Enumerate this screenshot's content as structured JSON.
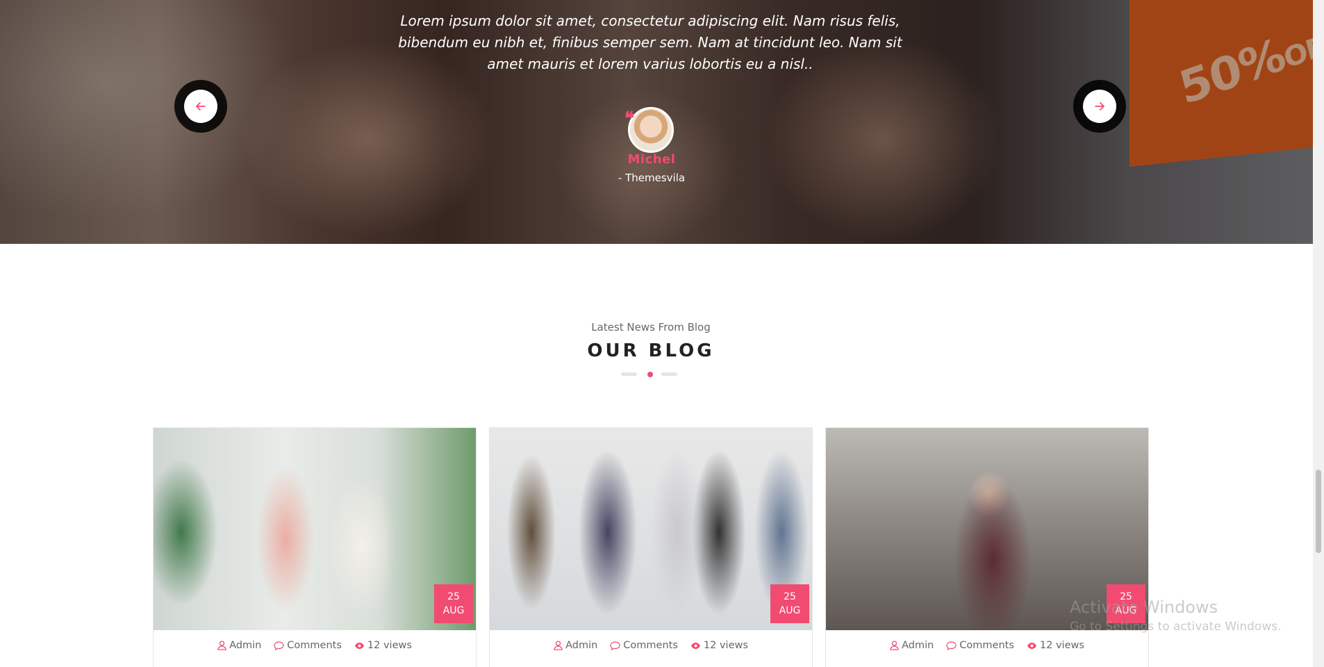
{
  "testimonial": {
    "quote": "Lorem ipsum dolor sit amet, consectetur adipiscing elit. Nam risus felis, bibendum eu nibh et, finibus semper sem. Nam at tincidunt leo. Nam sit amet mauris et lorem varius lobortis eu a nisl..",
    "author_name": "Michel",
    "author_company": "- Themesvila",
    "quote_mark": "❝",
    "prev_icon": "arrow-left-icon",
    "next_icon": "arrow-right-icon",
    "background_sign_text": "50%",
    "background_sign_small": "OFF"
  },
  "blog": {
    "subtitle": "Latest News From Blog",
    "title": "OUR BLOG",
    "accent_color": "#f14b71",
    "posts": [
      {
        "day": "25",
        "month": "AUG",
        "author": "Admin",
        "comments": "Comments",
        "views": "12 views"
      },
      {
        "day": "25",
        "month": "AUG",
        "author": "Admin",
        "comments": "Comments",
        "views": "12 views"
      },
      {
        "day": "25",
        "month": "AUG",
        "author": "Admin",
        "comments": "Comments",
        "views": "12 views"
      }
    ]
  },
  "watermark": {
    "title": "Activate Windows",
    "subtitle": "Go to Settings to activate Windows."
  }
}
